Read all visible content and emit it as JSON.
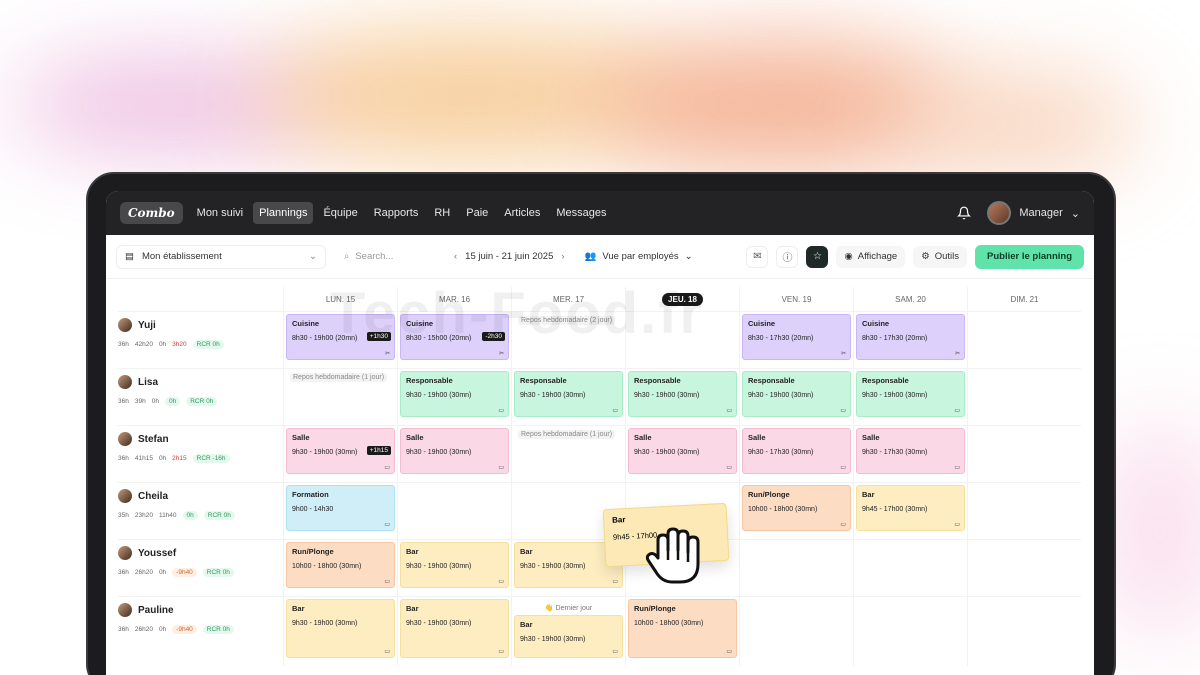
{
  "nav": {
    "logo": "Combo",
    "items": [
      "Mon suivi",
      "Plannings",
      "Équipe",
      "Rapports",
      "RH",
      "Paie",
      "Articles",
      "Messages"
    ],
    "active": "Plannings",
    "user": "Manager"
  },
  "toolbar": {
    "establishment": "Mon établissement",
    "search_placeholder": "Search...",
    "date_range": "15 juin - 21 juin 2025",
    "view": "Vue par employés",
    "display": "Affichage",
    "tools": "Outils",
    "publish": "Publier le planning"
  },
  "days": [
    "LUN. 15",
    "MAR. 16",
    "MER. 17",
    "JEU. 18",
    "VEN. 19",
    "SAM. 20",
    "DIM. 21"
  ],
  "today_index": 3,
  "employees": [
    {
      "name": "Yuji",
      "stats": [
        "36h",
        "42h20",
        "0h"
      ],
      "tags": [
        {
          "text": "3h20",
          "cls": "plain-red"
        },
        {
          "text": "RCR 0h",
          "cls": "tag tag-green"
        }
      ]
    },
    {
      "name": "Lisa",
      "stats": [
        "36h",
        "39h",
        "0h"
      ],
      "tags": [
        {
          "text": "0h",
          "cls": "tag tag-green"
        },
        {
          "text": "RCR 0h",
          "cls": "tag tag-green"
        }
      ]
    },
    {
      "name": "Stefan",
      "stats": [
        "36h",
        "41h15",
        "0h"
      ],
      "tags": [
        {
          "text": "2h15",
          "cls": "plain-red"
        },
        {
          "text": "RCR -16h",
          "cls": "tag tag-green"
        }
      ]
    },
    {
      "name": "Cheila",
      "stats": [
        "35h",
        "23h20",
        "11h40"
      ],
      "tags": [
        {
          "text": "0h",
          "cls": "tag tag-green"
        },
        {
          "text": "RCR 0h",
          "cls": "tag tag-green"
        }
      ]
    },
    {
      "name": "Youssef",
      "stats": [
        "36h",
        "26h20",
        "0h"
      ],
      "tags": [
        {
          "text": "-9h40",
          "cls": "tag tag-orange"
        },
        {
          "text": "RCR 0h",
          "cls": "tag tag-green"
        }
      ]
    },
    {
      "name": "Pauline",
      "stats": [
        "36h",
        "26h20",
        "0h"
      ],
      "tags": [
        {
          "text": "-9h40",
          "cls": "tag tag-orange"
        },
        {
          "text": "RCR 0h",
          "cls": "tag tag-green"
        }
      ]
    }
  ],
  "shifts": [
    [
      {
        "type": "shift",
        "color": "purple",
        "role": "Cuisine",
        "time": "8h30 - 19h00 (20mn)",
        "badge": "+1h30",
        "icon": "✂"
      },
      {
        "type": "shift",
        "color": "purple",
        "role": "Cuisine",
        "time": "8h30 - 15h00 (20mn)",
        "badge": "-2h30",
        "icon": "✂"
      },
      {
        "type": "repos",
        "text": "Repos hebdomadaire (2 jour)"
      },
      {
        "type": "empty"
      },
      {
        "type": "shift",
        "color": "purple",
        "role": "Cuisine",
        "time": "8h30 - 17h30 (20mn)",
        "icon": "✂"
      },
      {
        "type": "shift",
        "color": "purple",
        "role": "Cuisine",
        "time": "8h30 - 17h30 (20mn)",
        "icon": "✂"
      },
      {
        "type": "empty"
      }
    ],
    [
      {
        "type": "repos",
        "text": "Repos hebdomadaire (1 jour)"
      },
      {
        "type": "shift",
        "color": "green",
        "role": "Responsable",
        "time": "9h30 - 19h00 (30mn)",
        "icon": "▭"
      },
      {
        "type": "shift",
        "color": "green",
        "role": "Responsable",
        "time": "9h30 - 19h00 (30mn)",
        "icon": "▭"
      },
      {
        "type": "shift",
        "color": "green",
        "role": "Responsable",
        "time": "9h30 - 19h00 (30mn)",
        "icon": "▭"
      },
      {
        "type": "shift",
        "color": "green",
        "role": "Responsable",
        "time": "9h30 - 19h00 (30mn)",
        "icon": "▭"
      },
      {
        "type": "shift",
        "color": "green",
        "role": "Responsable",
        "time": "9h30 - 19h00 (30mn)",
        "icon": "▭"
      },
      {
        "type": "empty"
      }
    ],
    [
      {
        "type": "shift",
        "color": "pink",
        "role": "Salle",
        "time": "9h30 - 19h00 (30mn)",
        "badge": "+1h15",
        "icon": "▭"
      },
      {
        "type": "shift",
        "color": "pink",
        "role": "Salle",
        "time": "9h30 - 19h00 (30mn)",
        "icon": "▭"
      },
      {
        "type": "repos",
        "text": "Repos hebdomadaire (1 jour)"
      },
      {
        "type": "shift",
        "color": "pink",
        "role": "Salle",
        "time": "9h30 - 19h00 (30mn)",
        "icon": "▭"
      },
      {
        "type": "shift",
        "color": "pink",
        "role": "Salle",
        "time": "9h30 - 17h30 (30mn)",
        "icon": "▭"
      },
      {
        "type": "shift",
        "color": "pink",
        "role": "Salle",
        "time": "9h30 - 17h30 (30mn)",
        "icon": "▭"
      },
      {
        "type": "empty"
      }
    ],
    [
      {
        "type": "shift",
        "color": "blue",
        "role": "Formation",
        "time": "9h00 - 14h30",
        "icon": "▭"
      },
      {
        "type": "empty"
      },
      {
        "type": "empty"
      },
      {
        "type": "empty"
      },
      {
        "type": "shift",
        "color": "peach",
        "role": "Run/Plonge",
        "time": "10h00 - 18h00 (30mn)",
        "icon": "▭"
      },
      {
        "type": "shift",
        "color": "yellow",
        "role": "Bar",
        "time": "9h45 - 17h00 (30mn)",
        "icon": "▭"
      },
      {
        "type": "empty"
      }
    ],
    [
      {
        "type": "shift",
        "color": "peach",
        "role": "Run/Plonge",
        "time": "10h00 - 18h00 (30mn)",
        "icon": "▭"
      },
      {
        "type": "shift",
        "color": "yellow",
        "role": "Bar",
        "time": "9h30 - 19h00 (30mn)",
        "icon": "▭"
      },
      {
        "type": "shift",
        "color": "yellow",
        "role": "Bar",
        "time": "9h30 - 19h00 (30mn)",
        "icon": "▭"
      },
      {
        "type": "empty"
      },
      {
        "type": "empty"
      },
      {
        "type": "empty"
      },
      {
        "type": "empty"
      }
    ],
    [
      {
        "type": "shift",
        "color": "yellow",
        "role": "Bar",
        "time": "9h30 - 19h00 (30mn)",
        "icon": "▭"
      },
      {
        "type": "shift",
        "color": "yellow",
        "role": "Bar",
        "time": "9h30 - 19h00 (30mn)",
        "icon": "▭"
      },
      {
        "type": "shift",
        "color": "yellow",
        "role": "Bar",
        "time": "9h30 - 19h00 (30mn)",
        "icon": "▭",
        "note": "👋 Dernier jour"
      },
      {
        "type": "shift",
        "color": "peach",
        "role": "Run/Plonge",
        "time": "10h00 - 18h00 (30mn)",
        "icon": "▭"
      },
      {
        "type": "empty"
      },
      {
        "type": "empty"
      },
      {
        "type": "empty"
      }
    ]
  ],
  "drag_card": {
    "role": "Bar",
    "time": "9h45 - 17h00"
  },
  "watermark": "Tech-Food.fr"
}
